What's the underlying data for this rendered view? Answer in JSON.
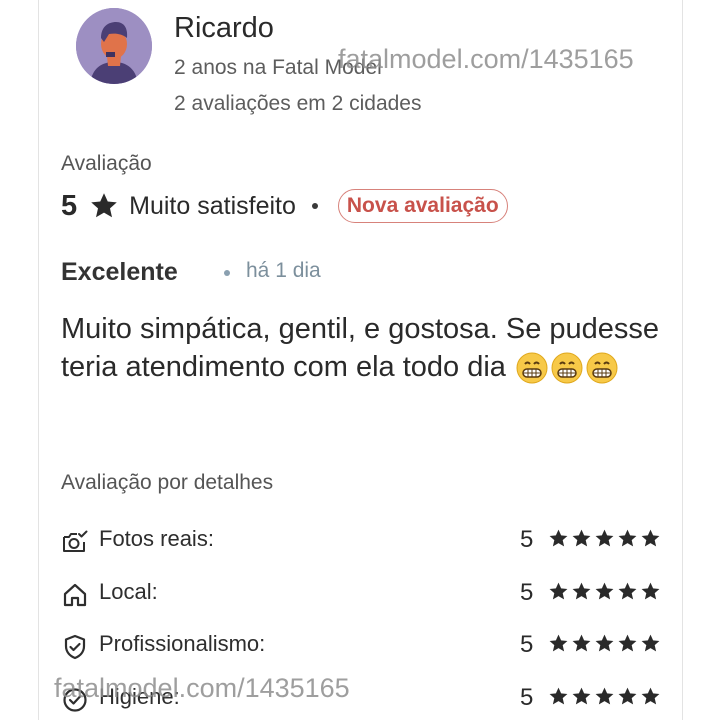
{
  "reviewer": {
    "name": "Ricardo",
    "tenure": "2 anos na Fatal Model",
    "reviews_summary": "2 avaliações em 2 cidades"
  },
  "watermarks": {
    "top": "fatalmodel.com/1435165",
    "bottom": "fatalmodel.com/1435165"
  },
  "rating": {
    "section_label": "Avaliação",
    "score": "5",
    "sentiment": "Muito satisfeito",
    "badge": "Nova avaliação"
  },
  "review": {
    "title": "Excelente",
    "time": "há 1 dia",
    "text": "Muito simpática, gentil, e gostosa. Se pudesse teria atendimento com ela todo dia",
    "emoji_count": 3
  },
  "details": {
    "section_label": "Avaliação por detalhes",
    "items": [
      {
        "label": "Fotos reais:",
        "score": "5",
        "stars": 5,
        "icon": "camera-check-icon"
      },
      {
        "label": "Local:",
        "score": "5",
        "stars": 5,
        "icon": "home-icon"
      },
      {
        "label": "Profissionalismo:",
        "score": "5",
        "stars": 5,
        "icon": "shield-check-icon"
      },
      {
        "label": "Higiene:",
        "score": "5",
        "stars": 5,
        "icon": "check-circle-icon"
      }
    ]
  },
  "colors": {
    "badge_text": "#c8524b",
    "badge_border": "#d7827b",
    "avatar_bg": "#9d8fc2",
    "time_text": "#7c8f9c"
  }
}
